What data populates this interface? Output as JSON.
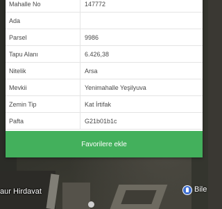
{
  "parcel_info": {
    "rows": [
      {
        "label": "Mahalle No",
        "value": "147772"
      },
      {
        "label": "Ada",
        "value": ""
      },
      {
        "label": "Parsel",
        "value": "9986"
      },
      {
        "label": "Tapu Alanı",
        "value": "6.426,38"
      },
      {
        "label": "Nitelik",
        "value": "Arsa"
      },
      {
        "label": "Mevkii",
        "value": "Yenimahalle Yeşilyuva"
      },
      {
        "label": "Zemin Tip",
        "value": "Kat İrtifak"
      },
      {
        "label": "Pafta",
        "value": "G21b01b1c"
      }
    ],
    "favorite_button": "Favorilere ekle",
    "accent_color": "#43b05c"
  },
  "map": {
    "label_left": "aur Hirdavat",
    "label_right": "Bile",
    "pin_icon": "pin-icon"
  }
}
